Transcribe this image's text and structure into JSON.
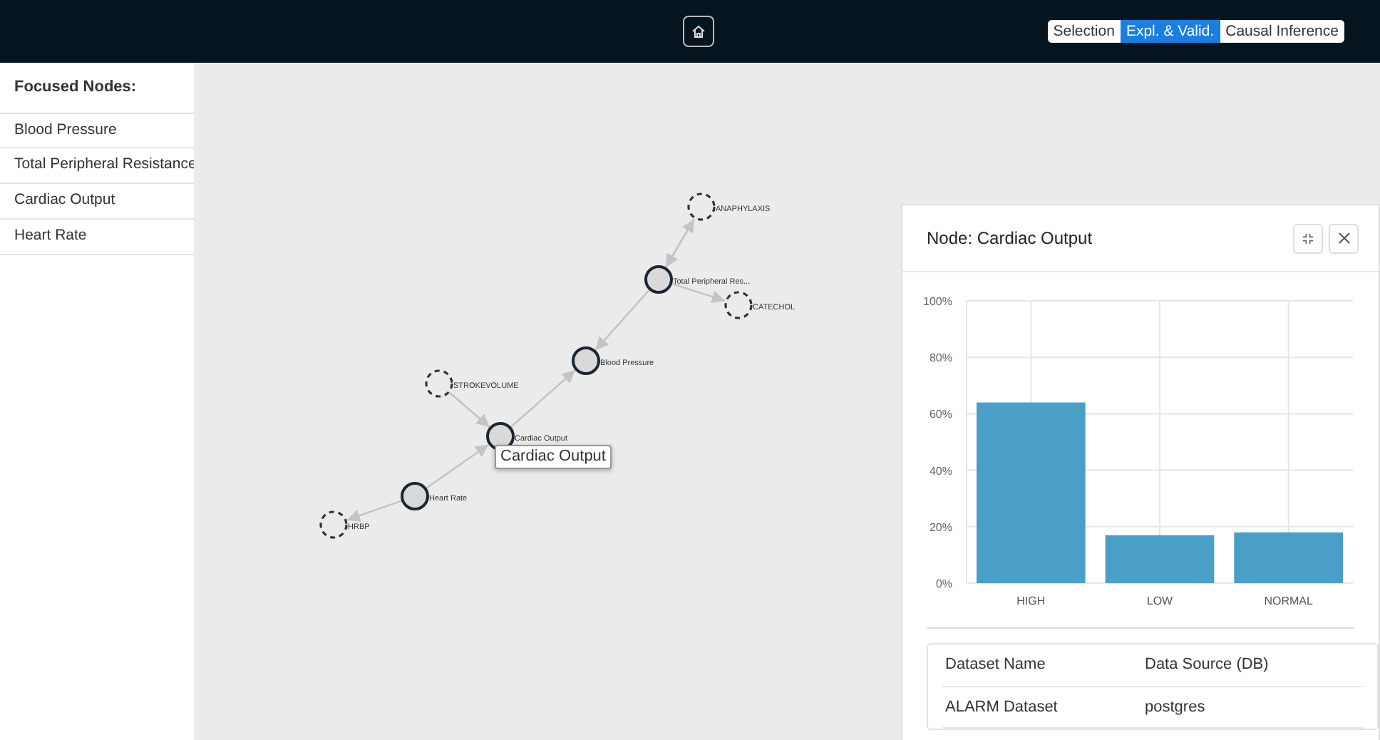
{
  "navbar": {
    "modes": [
      {
        "label": "Selection",
        "selected": false
      },
      {
        "label": "Expl. & Valid.",
        "selected": true
      },
      {
        "label": "Causal Inference",
        "selected": false
      }
    ]
  },
  "sidebar": {
    "title": "Focused Nodes:",
    "items": [
      "Blood Pressure",
      "Total Peripheral Resistance",
      "Cardiac Output",
      "Heart Rate"
    ]
  },
  "graph": {
    "nodes": [
      {
        "label": "ANAPHYLAXIS",
        "kind": "hidden"
      },
      {
        "label": "Total Peripheral Res...",
        "kind": "focused"
      },
      {
        "label": "CATECHOL",
        "kind": "hidden"
      },
      {
        "label": "Blood Pressure",
        "kind": "focused"
      },
      {
        "label": "STROKEVOLUME",
        "kind": "hidden"
      },
      {
        "label": "Cardiac Output",
        "kind": "focused"
      },
      {
        "label": "Heart Rate",
        "kind": "focused"
      },
      {
        "label": "HRBP",
        "kind": "hidden"
      }
    ],
    "tooltip": "Cardiac Output"
  },
  "panel": {
    "title": "Node: Cardiac Output",
    "chart_data": {
      "type": "bar",
      "categories": [
        "HIGH",
        "LOW",
        "NORMAL"
      ],
      "series": [
        {
          "color": "#4a9fc6",
          "values": [
            0.64,
            0.17,
            0.18
          ]
        }
      ],
      "grid": true,
      "ylim": [
        0,
        1
      ],
      "yticks": [
        {
          "value": 0,
          "label": "0%"
        },
        {
          "value": 0.2,
          "label": "20%"
        },
        {
          "value": 0.4,
          "label": "40%"
        },
        {
          "value": 0.6,
          "label": "60%"
        },
        {
          "value": 0.8,
          "label": "80%"
        },
        {
          "value": 1,
          "label": "100%"
        }
      ]
    },
    "table": {
      "columns": [
        "Dataset Name",
        "Data Source (DB)"
      ],
      "rows": [
        [
          "ALARM Dataset",
          "postgres"
        ]
      ]
    }
  }
}
